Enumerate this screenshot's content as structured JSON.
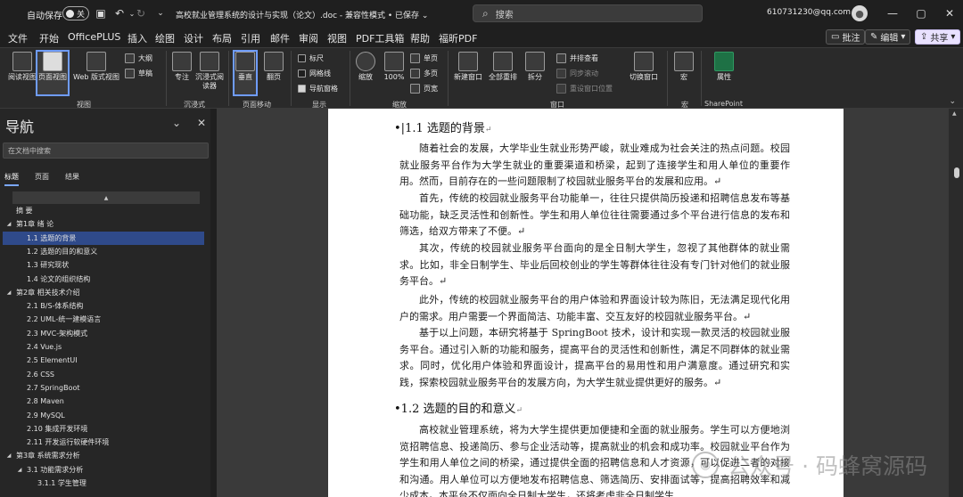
{
  "titlebar": {
    "autosave_label": "自动保存",
    "autosave_state": "关",
    "doc_title": "高校就业管理系统的设计与实现（论文）.doc  -  兼容性模式 • 已保存 ⌄",
    "search_placeholder": "搜索",
    "account_email": "610731230@qq.com"
  },
  "menu": {
    "items": [
      "文件",
      "开始",
      "OfficePLUS",
      "插入",
      "绘图",
      "设计",
      "布局",
      "引用",
      "邮件",
      "审阅",
      "视图",
      "PDF工具箱",
      "帮助",
      "福昕PDF"
    ],
    "active": "视图",
    "comment_btn": "批注",
    "edit_btn": "编辑",
    "share_btn": "共享"
  },
  "ribbon": {
    "btn_read": "阅读视图",
    "btn_print": "页面视图",
    "btn_web": "Web 版式视图",
    "btn_outline": "大纲",
    "btn_draft": "草稿",
    "grp_view": "视图",
    "btn_focus": "专注",
    "btn_reader": "沉浸式阅读器",
    "grp_immersive": "沉浸式",
    "btn_vertical": "垂直",
    "btn_side": "翻页",
    "grp_pagemove": "页面移动",
    "chk_ruler": "标尺",
    "chk_grid": "网格线",
    "chk_navpane": "导航窗格",
    "grp_show": "显示",
    "btn_zoom": "缩放",
    "btn_100": "100%",
    "btn_onepage": "单页",
    "btn_multipage": "多页",
    "btn_pagewidth": "页宽",
    "grp_zoom": "缩放",
    "btn_newwin": "新建窗口",
    "btn_arrange": "全部重排",
    "btn_split": "拆分",
    "btn_sidebyside": "并排查看",
    "btn_syncscroll": "同步滚动",
    "btn_resetpos": "重设窗口位置",
    "btn_switch": "切换窗口",
    "grp_window": "窗口",
    "btn_macro": "宏",
    "grp_macro": "宏",
    "btn_props": "属性",
    "grp_sharepoint": "SharePoint"
  },
  "nav": {
    "title": "导航",
    "search_placeholder": "在文档中搜索",
    "tabs": [
      "标题",
      "页面",
      "结果"
    ],
    "items": [
      {
        "label": "摘  要",
        "level": 1,
        "expand": ""
      },
      {
        "label": "第1章 绪 论",
        "level": 1,
        "expand": "◢"
      },
      {
        "label": "1.1 选题的背景",
        "level": 2,
        "expand": "",
        "active": true
      },
      {
        "label": "1.2 选题的目的和意义",
        "level": 2,
        "expand": ""
      },
      {
        "label": "1.3 研究现状",
        "level": 2,
        "expand": ""
      },
      {
        "label": "1.4 论文的组织结构",
        "level": 2,
        "expand": ""
      },
      {
        "label": "第2章 相关技术介绍",
        "level": 1,
        "expand": "◢"
      },
      {
        "label": "2.1 B/S-体系结构",
        "level": 2,
        "expand": ""
      },
      {
        "label": "2.2 UML-统一建模语言",
        "level": 2,
        "expand": ""
      },
      {
        "label": "2.3 MVC-架构模式",
        "level": 2,
        "expand": ""
      },
      {
        "label": "2.4 Vue.js",
        "level": 2,
        "expand": ""
      },
      {
        "label": "2.5 ElementUI",
        "level": 2,
        "expand": ""
      },
      {
        "label": "2.6 CSS",
        "level": 2,
        "expand": ""
      },
      {
        "label": "2.7 SpringBoot",
        "level": 2,
        "expand": ""
      },
      {
        "label": "2.8  Maven",
        "level": 2,
        "expand": ""
      },
      {
        "label": "2.9 MySQL",
        "level": 2,
        "expand": ""
      },
      {
        "label": "2.10 集成开发环境",
        "level": 2,
        "expand": ""
      },
      {
        "label": "2.11 开发运行软硬件环境",
        "level": 2,
        "expand": ""
      },
      {
        "label": "第3章 系统需求分析",
        "level": 1,
        "expand": "◢"
      },
      {
        "label": "3.1 功能需求分析",
        "level": 2,
        "expand": "◢"
      },
      {
        "label": "3.1.1 学生管理",
        "level": 3,
        "expand": ""
      }
    ]
  },
  "doc": {
    "h1": "1.1   选题的背景",
    "p1": "随着社会的发展，大学毕业生就业形势严峻，就业难成为社会关注的热点问题。校园就业服务平台作为大学生就业的重要渠道和桥梁，起到了连接学生和用人单位的重要作用。然而，目前存在的一些问题限制了校园就业服务平台的发展和应用。↵",
    "p2": "首先，传统的校园就业服务平台功能单一，往往只提供简历投递和招聘信息发布等基础功能，缺乏灵活性和创新性。学生和用人单位往往需要通过多个平台进行信息的发布和筛选，给双方带来了不便。↵",
    "p3": "其次，传统的校园就业服务平台面向的是全日制大学生，忽视了其他群体的就业需求。比如，非全日制学生、毕业后回校创业的学生等群体往往没有专门针对他们的就业服务平台。↵",
    "p4": "此外，传统的校园就业服务平台的用户体验和界面设计较为陈旧，无法满足现代化用户的需求。用户需要一个界面简洁、功能丰富、交互友好的校园就业服务平台。↵",
    "p5": "基于以上问题，本研究将基于 SpringBoot 技术，设计和实现一款灵活的校园就业服务平台。通过引入新的功能和服务，提高平台的灵活性和创新性，满足不同群体的就业需求。同时，优化用户体验和界面设计，提高平台的易用性和用户满意度。通过研究和实践，探索校园就业服务平台的发展方向，为大学生就业提供更好的服务。↵",
    "h2": "1.2   选题的目的和意义",
    "p6": "高校就业管理系统，将为大学生提供更加便捷和全面的就业服务。学生可以方便地浏览招聘信息、投递简历、参与企业活动等，提高就业的机会和成功率。校园就业平台作为学生和用人单位之间的桥梁，通过提供全面的招聘信息和人才资源，可以促进二者的对接和沟通。用人单位可以方便地发布招聘信息、筛选简历、安排面试等，提高招聘效率和减少成本。本平台不仅面向全日制大学生，还将考虑非全日制学生"
  },
  "watermark": {
    "text": "公众号 · 码蜂窝源码"
  },
  "colors": {
    "accent": "#7aa7ff",
    "nav_active": "#2f4a8a",
    "share_btn": "#e9e1ff"
  }
}
